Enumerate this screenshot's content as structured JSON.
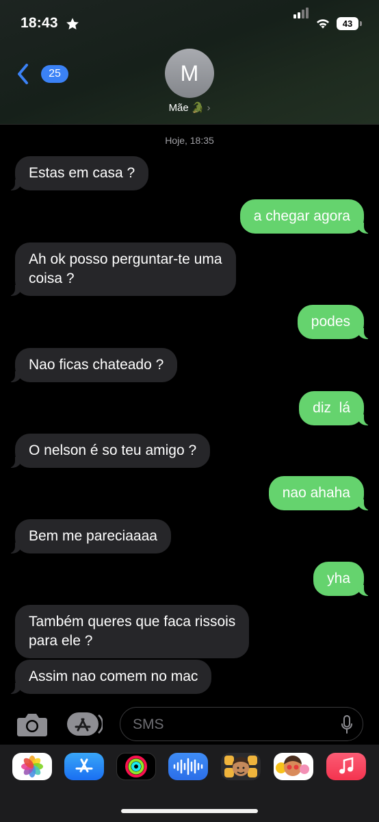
{
  "status_bar": {
    "time": "18:43",
    "star_icon": "star-icon",
    "signal_icon": "cellular-signal-icon",
    "wifi_icon": "wifi-icon",
    "battery_level": "43"
  },
  "header": {
    "back_count": "25",
    "avatar_initial": "M",
    "contact_name": "Mãe",
    "contact_emoji": "🐊",
    "chevron": "›"
  },
  "conversation": {
    "timestamp": "Hoje, 18:35",
    "messages": [
      {
        "direction": "in",
        "text": "Estas em casa ?"
      },
      {
        "direction": "out",
        "text": "a chegar agora"
      },
      {
        "direction": "in",
        "text": "Ah ok posso perguntar-te uma\ncoisa ?"
      },
      {
        "direction": "out",
        "text": "podes"
      },
      {
        "direction": "in",
        "text": "Nao ficas chateado ?"
      },
      {
        "direction": "out",
        "text": "diz  lá"
      },
      {
        "direction": "in",
        "text": "O nelson é so teu amigo ?"
      },
      {
        "direction": "out",
        "text": "nao ahaha"
      },
      {
        "direction": "in",
        "text": "Bem me pareciaaaa"
      },
      {
        "direction": "out",
        "text": "yha"
      },
      {
        "direction": "in",
        "text": "Também queres que faca rissois\npara ele ?"
      },
      {
        "direction": "in",
        "text": "Assim nao comem no mac"
      }
    ]
  },
  "input_bar": {
    "placeholder": "SMS",
    "camera_icon": "camera-icon",
    "apps_icon": "app-store-icon",
    "mic_icon": "microphone-icon"
  },
  "app_drawer": {
    "apps": [
      "photos",
      "app-store",
      "activity",
      "audio-message",
      "memoji",
      "memoji-stickers",
      "music"
    ]
  },
  "colors": {
    "outgoing_bubble": "#65d36e",
    "incoming_bubble": "#262629",
    "badge": "#3b82f6"
  }
}
